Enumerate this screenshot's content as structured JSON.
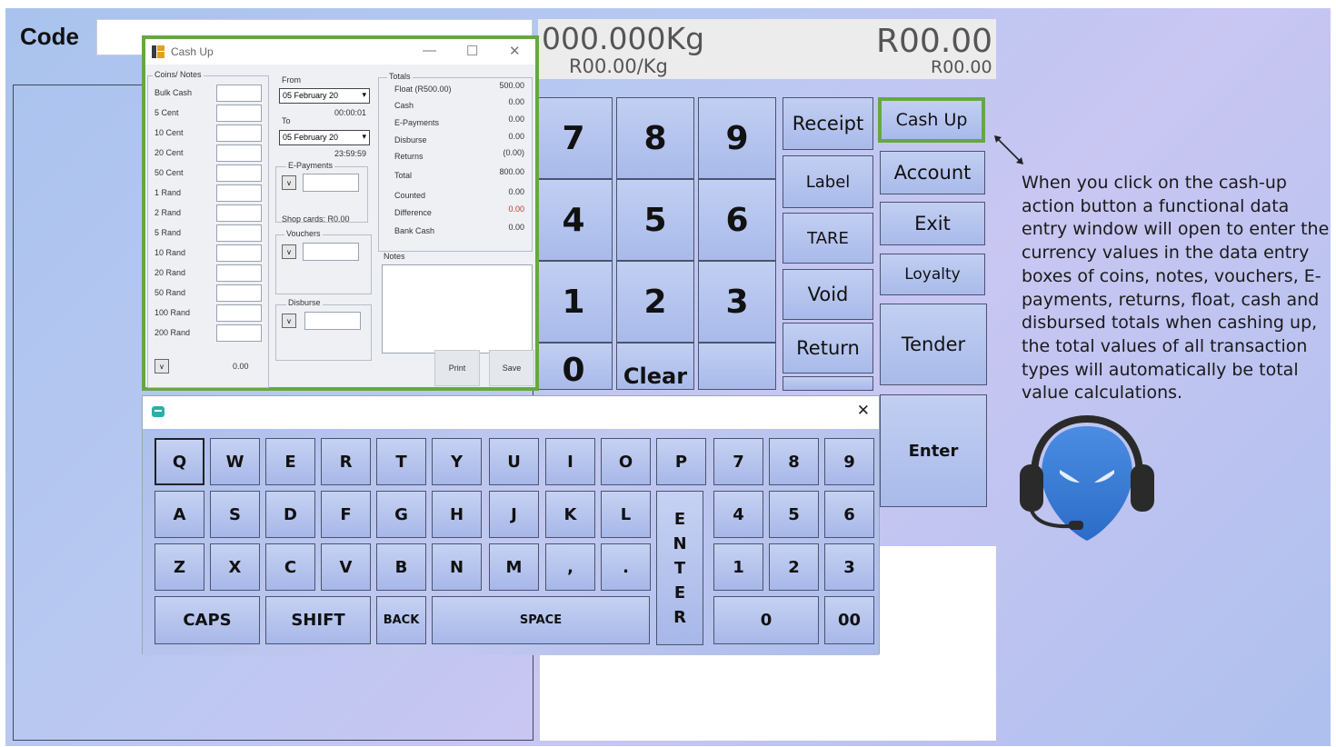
{
  "header": {
    "code_label": "Code",
    "weight": "000.000Kg",
    "unit_price": "R00.00/Kg",
    "total": "R00.00",
    "subtotal": "R00.00"
  },
  "keypad": {
    "digits": [
      "7",
      "8",
      "9",
      "4",
      "5",
      "6",
      "1",
      "2",
      "3",
      "0",
      "Clear"
    ],
    "actions": {
      "receipt": "Receipt",
      "label": "Label",
      "tare": "TARE",
      "void": "Void",
      "return": "Return",
      "cash_up": "Cash Up",
      "account": "Account",
      "exit": "Exit",
      "loyalty": "Loyalty",
      "tender": "Tender",
      "enter": "Enter"
    }
  },
  "annotation": "When you click on the cash-up action button a functional data entry window will open to enter the currency values in the data entry boxes of coins, notes, vouchers, E-payments, returns, float, cash and disbursed totals when cashing up, the total values of all transaction types will automatically be total value calculations.",
  "cashup_window": {
    "title": "Cash Up",
    "controls": {
      "min": "—",
      "max": "☐",
      "close": "✕"
    },
    "coins_group": "Coins/ Notes",
    "coins": [
      "Bulk Cash",
      "5 Cent",
      "10 Cent",
      "20 Cent",
      "50 Cent",
      "1 Rand",
      "2 Rand",
      "5 Rand",
      "10 Rand",
      "20 Rand",
      "50 Rand",
      "100 Rand",
      "200 Rand"
    ],
    "coins_total": "0.00",
    "v_label": "v",
    "from_label": "From",
    "from_date": "05  February  20",
    "from_time": "00:00:01",
    "to_label": "To",
    "to_date": "05  February  20",
    "to_time": "23:59:59",
    "epayments_label": "E-Payments",
    "shop_cards": "Shop cards: R0.00",
    "vouchers_label": "Vouchers",
    "disburse_label": "Disburse",
    "totals_label": "Totals",
    "totals": [
      {
        "label": "Float (R500.00)",
        "value": "500.00"
      },
      {
        "label": "Cash",
        "value": "0.00"
      },
      {
        "label": "E-Payments",
        "value": "0.00"
      },
      {
        "label": "Disburse",
        "value": "0.00"
      },
      {
        "label": "Returns",
        "value": "(0.00)"
      },
      {
        "label": "Total",
        "value": "800.00"
      },
      {
        "label": "Counted",
        "value": "0.00"
      },
      {
        "label": "Difference",
        "value": "0.00"
      },
      {
        "label": "Bank Cash",
        "value": "0.00"
      }
    ],
    "difference_color": "#c0392b",
    "notes_label": "Notes",
    "print": "Print",
    "save": "Save"
  },
  "keyboard": {
    "close": "✕",
    "row1": [
      "Q",
      "W",
      "E",
      "R",
      "T",
      "Y",
      "U",
      "I",
      "O",
      "P"
    ],
    "row2": [
      "A",
      "S",
      "D",
      "F",
      "G",
      "H",
      "J",
      "K",
      "L"
    ],
    "row3": [
      "Z",
      "X",
      "C",
      "V",
      "B",
      "N",
      "M",
      ",",
      "."
    ],
    "enter_letters": [
      "E",
      "N",
      "T",
      "E",
      "R"
    ],
    "numpad": [
      "7",
      "8",
      "9",
      "4",
      "5",
      "6",
      "1",
      "2",
      "3"
    ],
    "caps": "CAPS",
    "shift": "SHIFT",
    "back": "BACK",
    "space": "SPACE",
    "zero": "0",
    "double_zero": "00"
  },
  "colors": {
    "highlight": "#65a843",
    "background": "#b8c8f1"
  }
}
